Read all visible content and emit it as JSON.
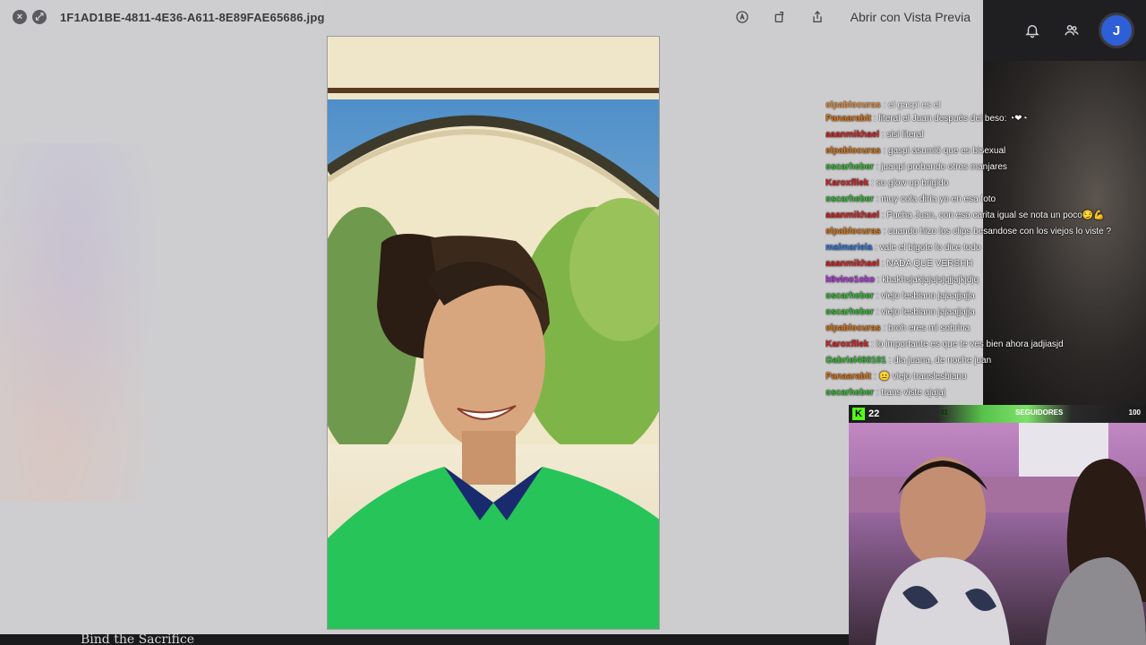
{
  "quicklook": {
    "filename": "1F1AD1BE-4811-4E36-A611-8E89FAE65686.jpg",
    "open_with_label": "Abrir con Vista Previa"
  },
  "stream": {
    "avatar_letter": "J",
    "behind_text": "Bind the Sacrifice"
  },
  "chat": {
    "messages": [
      {
        "user": "elpablocuras",
        "text": " : el gaspi es el",
        "color": "#e07a1a"
      },
      {
        "user": "Panaarabit",
        "text": " : literal el Juan después del beso: ◔❤◔",
        "color": "#e07a1a"
      },
      {
        "user": "aaanmikhael",
        "text": " : sisi literal",
        "color": "#d62828"
      },
      {
        "user": "elpablocuras",
        "text": " : gaspi asumió que es bisexual",
        "color": "#e07a1a"
      },
      {
        "user": "oscarheber",
        "text": " : juanpi probando otros manjares",
        "color": "#3ec23e"
      },
      {
        "user": "Karoxfllek",
        "text": " : su glow up brigido",
        "color": "#d62828"
      },
      {
        "user": "oscarheber",
        "text": " : muy cola diría yo en esa foto",
        "color": "#3ec23e"
      },
      {
        "user": "aaanmikhael",
        "text": " : Pucha Juan, con esa carita igual se nota un poco😏💪",
        "color": "#d62828"
      },
      {
        "user": "elpablocuras",
        "text": " : cuando hizo los clips besandose con los viejos lo viste ?",
        "color": "#e07a1a"
      },
      {
        "user": "malmariela",
        "text": " : vale el bigote lo dice todo",
        "color": "#3a7be0"
      },
      {
        "user": "aaanmikhael",
        "text": " : NADA QUE VERSHH",
        "color": "#d62828"
      },
      {
        "user": "k6vino1oko",
        "text": " : khakhsjakjajajsjqjjajkjdjq",
        "color": "#b43ae0"
      },
      {
        "user": "oscarheber",
        "text": " : viejo lesbiano jajaajjajja",
        "color": "#3ec23e"
      },
      {
        "user": "oscarheber",
        "text": " : viejo lesbiano jajaajjajja",
        "color": "#3ec23e"
      },
      {
        "user": "elpablocuras",
        "text": " : broh eres mi sobrina",
        "color": "#e07a1a"
      },
      {
        "user": "Karoxfllek",
        "text": " : lo importante es que te ves bien ahora jadjiasjd",
        "color": "#d62828"
      },
      {
        "user": "Gabriel460101",
        "text": " : dia juana, de noche juan",
        "color": "#3ec23e"
      },
      {
        "user": "Panaarabit",
        "text": " : 😐 viejo translesbiano",
        "color": "#e07a1a"
      },
      {
        "user": "oscarheber",
        "text": " : trans viste ajajaj",
        "color": "#3ec23e"
      }
    ]
  },
  "webcam": {
    "viewer_count": "22",
    "current": "41",
    "label": "SEGUIDORES",
    "goal": "100"
  }
}
